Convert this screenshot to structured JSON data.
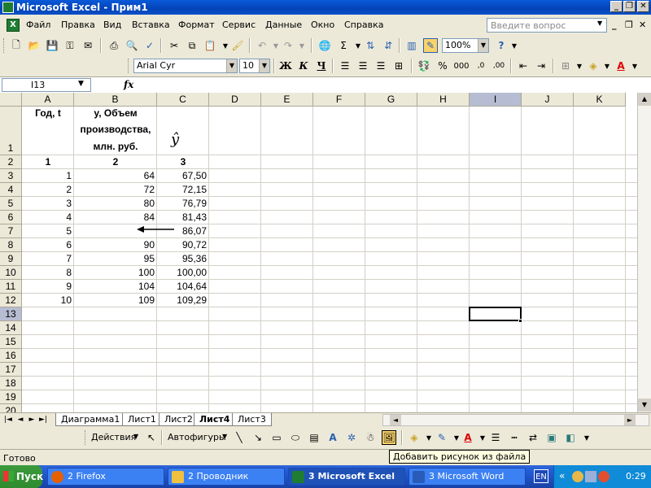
{
  "window": {
    "title": "Microsoft Excel - Прим1"
  },
  "menu": [
    "Файл",
    "Правка",
    "Вид",
    "Вставка",
    "Формат",
    "Сервис",
    "Данные",
    "Окно",
    "Справка"
  ],
  "ask_placeholder": "Введите вопрос",
  "toolbar": {
    "zoom": "100%",
    "font": "Arial Cyr",
    "font_size": "10",
    "bold": "Ж",
    "italic": "К",
    "underline": "Ч",
    "percent": "%",
    "thousands": "000",
    "sum": "Σ",
    "help": "?"
  },
  "formula_bar": {
    "name_box": "I13",
    "fx": "fx",
    "content": ""
  },
  "columns": [
    "A",
    "B",
    "C",
    "D",
    "E",
    "F",
    "G",
    "H",
    "I",
    "J",
    "K"
  ],
  "rows": [
    "1",
    "2",
    "3",
    "4",
    "5",
    "6",
    "7",
    "8",
    "9",
    "10",
    "11",
    "12",
    "13",
    "14",
    "15",
    "16",
    "17",
    "18",
    "19",
    "20"
  ],
  "header": {
    "a1": "Год, t",
    "b1_line1": "y, Объем",
    "b1_line2": "производства,",
    "b1_line3": "млн. руб.",
    "c1_symbol": "ŷ",
    "num_a": "1",
    "num_b": "2",
    "num_c": "3"
  },
  "table": [
    [
      "1",
      "64",
      "67,50"
    ],
    [
      "2",
      "72",
      "72,15"
    ],
    [
      "3",
      "80",
      "76,79"
    ],
    [
      "4",
      "84",
      "81,43"
    ],
    [
      "5",
      "",
      "86,07"
    ],
    [
      "6",
      "90",
      "90,72"
    ],
    [
      "7",
      "95",
      "95,36"
    ],
    [
      "8",
      "100",
      "100,00"
    ],
    [
      "9",
      "104",
      "104,64"
    ],
    [
      "10",
      "109",
      "109,29"
    ]
  ],
  "sheet_tabs": [
    "Диаграмма1",
    "Лист1",
    "Лист2",
    "Лист4",
    "Лист3"
  ],
  "active_sheet": "Лист4",
  "drawing": {
    "actions": "Действия",
    "autoshapes": "Автофигуры"
  },
  "tooltip": "Добавить рисунок из файла",
  "status": "Готово",
  "taskbar": {
    "start": "Пуск",
    "firefox": "2 Firefox",
    "explorer": "2 Проводник",
    "excel": "3 Microsoft Excel",
    "word": "3 Microsoft Word",
    "lang": "EN",
    "time": "0:29"
  },
  "colors": {
    "titlebar": "#0a5ad9",
    "selection_header": "#b6bdd2",
    "excel_green": "#1e7d32"
  }
}
